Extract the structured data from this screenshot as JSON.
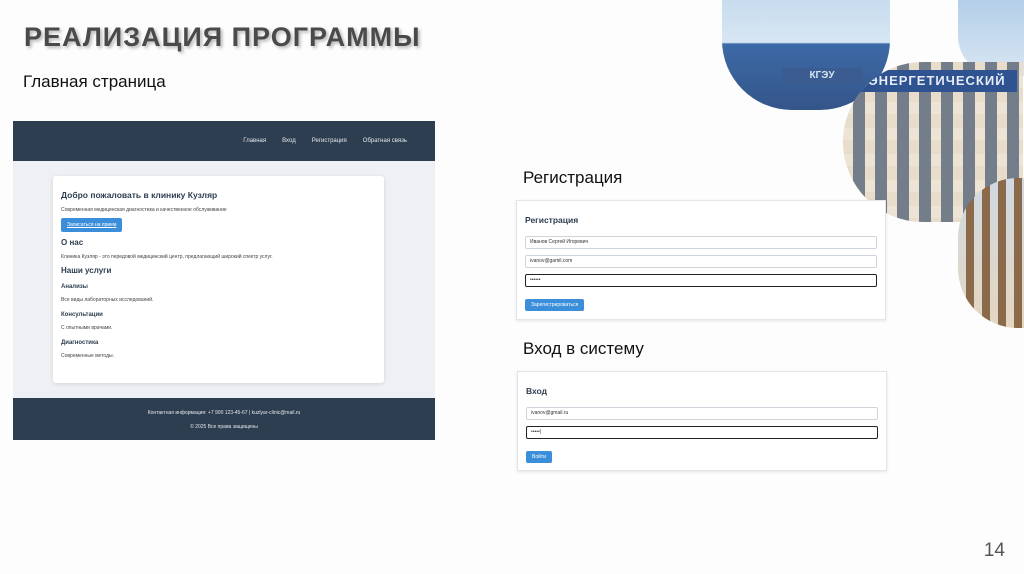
{
  "slide": {
    "title": "РЕАЛИЗАЦИЯ ПРОГРАММЫ",
    "page_number": "14",
    "labels": {
      "main": "Главная страница",
      "registration": "Регистрация",
      "login": "Вход в систему"
    }
  },
  "decor": {
    "sign_small": "КГЭУ",
    "sign_banner": "ЭНЕРГЕТИЧЕСКИЙ"
  },
  "main_page": {
    "nav": [
      "Главная",
      "Вход",
      "Регистрация",
      "Обратная связь"
    ],
    "welcome_title": "Добро пожаловать в клинику Кузляр",
    "welcome_text": "Современная медицинская диагностика и качественное обслуживание",
    "appointment_button": "Записаться на прием",
    "about_title": "О нас",
    "about_text": "Клиника Кузляр - это передовой медицинский центр, предлагающий широкий спектр услуг.",
    "services_title": "Наши услуги",
    "services": [
      {
        "title": "Анализы",
        "text": "Все виды лабораторных исследований."
      },
      {
        "title": "Консультации",
        "text": "С опытными врачами."
      },
      {
        "title": "Диагностика",
        "text": "Современные методы."
      }
    ],
    "footer_contacts": "Контактная информация: +7 900 123-45-67 | kuzlyar-clinic@mail.ru",
    "footer_copyright": "© 2025 Все права защищены"
  },
  "registration_form": {
    "title": "Регистрация",
    "fields": [
      "Иванов Сергей Игоревич",
      "ivanov@gamil.com",
      "••••••"
    ],
    "submit": "Зарегистрироваться"
  },
  "login_form": {
    "title": "Вход",
    "fields": [
      "ivanov@gmail.ru",
      "•••••|"
    ],
    "submit": "Войти"
  }
}
